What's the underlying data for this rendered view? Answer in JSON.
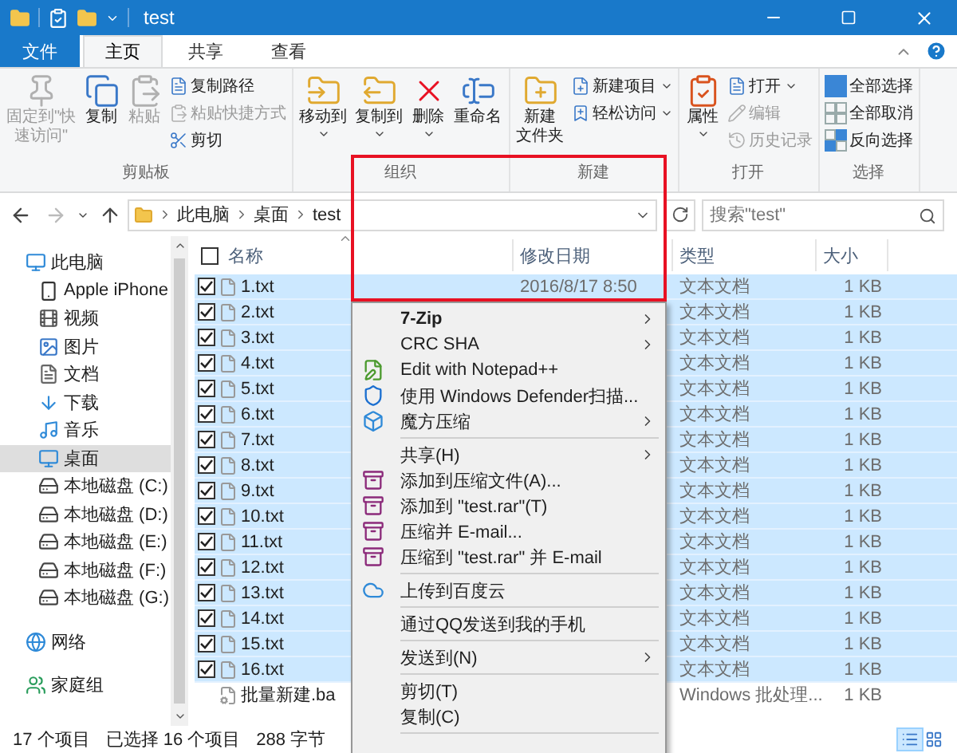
{
  "window": {
    "title": "test"
  },
  "tabs": [
    {
      "label": "文件",
      "kind": "file",
      "selected": false
    },
    {
      "label": "主页",
      "kind": "tab",
      "selected": true
    },
    {
      "label": "共享",
      "kind": "tab",
      "selected": false
    },
    {
      "label": "查看",
      "kind": "tab",
      "selected": false
    }
  ],
  "ribbon": {
    "groups": [
      {
        "label": "剪贴板",
        "items": [
          {
            "lines": [
              "固定到\"快",
              "速访问\""
            ],
            "kind": "large",
            "disabled": true,
            "dropdown": false
          },
          {
            "lines": [
              "复制"
            ],
            "kind": "large",
            "disabled": false,
            "dropdown": false
          },
          {
            "lines": [
              "粘贴"
            ],
            "kind": "large",
            "disabled": true,
            "dropdown": false
          },
          {
            "lines": [
              "复制路径"
            ],
            "kind": "small",
            "disabled": false,
            "dropdown": false
          },
          {
            "lines": [
              "粘贴快捷方式"
            ],
            "kind": "small",
            "disabled": true,
            "dropdown": false
          },
          {
            "lines": [
              "剪切"
            ],
            "kind": "small",
            "disabled": false,
            "dropdown": false
          }
        ]
      },
      {
        "label": "组织",
        "items": [
          {
            "lines": [
              "移动到"
            ],
            "kind": "large",
            "disabled": false,
            "dropdown": true
          },
          {
            "lines": [
              "复制到"
            ],
            "kind": "large",
            "disabled": false,
            "dropdown": true
          },
          {
            "lines": [
              "删除"
            ],
            "kind": "large",
            "disabled": false,
            "dropdown": true
          },
          {
            "lines": [
              "重命名"
            ],
            "kind": "large",
            "disabled": false,
            "dropdown": false
          }
        ]
      },
      {
        "label": "新建",
        "items": [
          {
            "lines": [
              "新建",
              "文件夹"
            ],
            "kind": "large",
            "disabled": false,
            "dropdown": false
          },
          {
            "lines": [
              "新建项目"
            ],
            "kind": "small",
            "disabled": false,
            "dropdown": true
          },
          {
            "lines": [
              "轻松访问"
            ],
            "kind": "small",
            "disabled": false,
            "dropdown": true
          }
        ]
      },
      {
        "label": "打开",
        "items": [
          {
            "lines": [
              "属性"
            ],
            "kind": "large",
            "disabled": false,
            "dropdown": true
          },
          {
            "lines": [
              "打开"
            ],
            "kind": "small",
            "disabled": false,
            "dropdown": true
          },
          {
            "lines": [
              "编辑"
            ],
            "kind": "small",
            "disabled": true,
            "dropdown": false
          },
          {
            "lines": [
              "历史记录"
            ],
            "kind": "small",
            "disabled": true,
            "dropdown": false
          }
        ]
      },
      {
        "label": "选择",
        "items": [
          {
            "lines": [
              "全部选择"
            ],
            "kind": "small",
            "disabled": false,
            "dropdown": false
          },
          {
            "lines": [
              "全部取消"
            ],
            "kind": "small",
            "disabled": false,
            "dropdown": false
          },
          {
            "lines": [
              "反向选择"
            ],
            "kind": "small",
            "disabled": false,
            "dropdown": false
          }
        ]
      }
    ]
  },
  "address": {
    "path": [
      "此电脑",
      "桌面",
      "test"
    ]
  },
  "search": {
    "placeholder": "搜索\"test\""
  },
  "sidebar": {
    "items": [
      {
        "label": "此电脑",
        "selected": false,
        "children": [
          {
            "label": "Apple iPhone",
            "selected": false
          },
          {
            "label": "视频",
            "selected": false
          },
          {
            "label": "图片",
            "selected": false
          },
          {
            "label": "文档",
            "selected": false
          },
          {
            "label": "下载",
            "selected": false
          },
          {
            "label": "音乐",
            "selected": false
          },
          {
            "label": "桌面",
            "selected": true
          },
          {
            "label": "本地磁盘 (C:)",
            "selected": false
          },
          {
            "label": "本地磁盘 (D:)",
            "selected": false
          },
          {
            "label": "本地磁盘 (E:)",
            "selected": false
          },
          {
            "label": "本地磁盘 (F:)",
            "selected": false
          },
          {
            "label": "本地磁盘 (G:)",
            "selected": false
          }
        ]
      },
      {
        "label": "网络",
        "selected": false
      },
      {
        "label": "家庭组",
        "selected": false
      }
    ]
  },
  "table": {
    "columns": [
      "名称",
      "修改日期",
      "类型",
      "大小"
    ],
    "select_all_checked": false,
    "rows": [
      {
        "name": "1.txt",
        "date": "2016/8/17 8:50",
        "type": "文本文档",
        "size": "1 KB",
        "kind": "text",
        "selected": true,
        "checked": true
      },
      {
        "name": "2.txt",
        "type": "文本文档",
        "size": "1 KB",
        "kind": "text",
        "selected": true,
        "checked": true
      },
      {
        "name": "3.txt",
        "type": "文本文档",
        "size": "1 KB",
        "kind": "text",
        "selected": true,
        "checked": true
      },
      {
        "name": "4.txt",
        "type": "文本文档",
        "size": "1 KB",
        "kind": "text",
        "selected": true,
        "checked": true
      },
      {
        "name": "5.txt",
        "type": "文本文档",
        "size": "1 KB",
        "kind": "text",
        "selected": true,
        "checked": true
      },
      {
        "name": "6.txt",
        "type": "文本文档",
        "size": "1 KB",
        "kind": "text",
        "selected": true,
        "checked": true
      },
      {
        "name": "7.txt",
        "type": "文本文档",
        "size": "1 KB",
        "kind": "text",
        "selected": true,
        "checked": true
      },
      {
        "name": "8.txt",
        "type": "文本文档",
        "size": "1 KB",
        "kind": "text",
        "selected": true,
        "checked": true
      },
      {
        "name": "9.txt",
        "type": "文本文档",
        "size": "1 KB",
        "kind": "text",
        "selected": true,
        "checked": true
      },
      {
        "name": "10.txt",
        "type": "文本文档",
        "size": "1 KB",
        "kind": "text",
        "selected": true,
        "checked": true
      },
      {
        "name": "11.txt",
        "type": "文本文档",
        "size": "1 KB",
        "kind": "text",
        "selected": true,
        "checked": true
      },
      {
        "name": "12.txt",
        "type": "文本文档",
        "size": "1 KB",
        "kind": "text",
        "selected": true,
        "checked": true
      },
      {
        "name": "13.txt",
        "type": "文本文档",
        "size": "1 KB",
        "kind": "text",
        "selected": true,
        "checked": true
      },
      {
        "name": "14.txt",
        "type": "文本文档",
        "size": "1 KB",
        "kind": "text",
        "selected": true,
        "checked": true
      },
      {
        "name": "15.txt",
        "type": "文本文档",
        "size": "1 KB",
        "kind": "text",
        "selected": true,
        "checked": true
      },
      {
        "name": "16.txt",
        "type": "文本文档",
        "size": "1 KB",
        "kind": "text",
        "selected": true,
        "checked": true
      },
      {
        "name": "批量新建.ba",
        "type": "Windows 批处理...",
        "size": "1 KB",
        "kind": "batch",
        "selected": false,
        "checked": false
      }
    ]
  },
  "context_menu": {
    "items": [
      {
        "kind": "item",
        "label": "7-Zip",
        "bold": true,
        "submenu": true,
        "has_icon": false
      },
      {
        "kind": "item",
        "label": "CRC SHA",
        "bold": false,
        "submenu": true,
        "has_icon": false
      },
      {
        "kind": "item",
        "label": "Edit with Notepad++",
        "bold": false,
        "submenu": false,
        "has_icon": true
      },
      {
        "kind": "item",
        "label": "使用 Windows Defender扫描...",
        "bold": false,
        "submenu": false,
        "has_icon": true
      },
      {
        "kind": "item",
        "label": "魔方压缩",
        "bold": false,
        "submenu": true,
        "has_icon": true
      },
      {
        "kind": "separator"
      },
      {
        "kind": "item",
        "label": "共享(H)",
        "bold": false,
        "submenu": true,
        "has_icon": false
      },
      {
        "kind": "item",
        "label": "添加到压缩文件(A)...",
        "bold": false,
        "submenu": false,
        "has_icon": true
      },
      {
        "kind": "item",
        "label": "添加到 \"test.rar\"(T)",
        "bold": false,
        "submenu": false,
        "has_icon": true
      },
      {
        "kind": "item",
        "label": "压缩并 E-mail...",
        "bold": false,
        "submenu": false,
        "has_icon": true
      },
      {
        "kind": "item",
        "label": "压缩到 \"test.rar\" 并 E-mail",
        "bold": false,
        "submenu": false,
        "has_icon": true
      },
      {
        "kind": "separator"
      },
      {
        "kind": "item",
        "label": "上传到百度云",
        "bold": false,
        "submenu": false,
        "has_icon": true
      },
      {
        "kind": "separator"
      },
      {
        "kind": "item",
        "label": "通过QQ发送到我的手机",
        "bold": false,
        "submenu": false,
        "has_icon": false
      },
      {
        "kind": "separator"
      },
      {
        "kind": "item",
        "label": "发送到(N)",
        "bold": false,
        "submenu": true,
        "has_icon": false
      },
      {
        "kind": "separator"
      },
      {
        "kind": "item",
        "label": "剪切(T)",
        "bold": false,
        "submenu": false,
        "has_icon": false
      },
      {
        "kind": "item",
        "label": "复制(C)",
        "bold": false,
        "submenu": false,
        "has_icon": false
      },
      {
        "kind": "separator"
      }
    ]
  },
  "status_bar": {
    "items": [
      "17 个项目",
      "已选择 16 个项目",
      "288 字节"
    ],
    "views": [
      {
        "kind": "details",
        "selected": true
      },
      {
        "kind": "large_icons",
        "selected": false
      }
    ]
  },
  "highlight_frame": true
}
